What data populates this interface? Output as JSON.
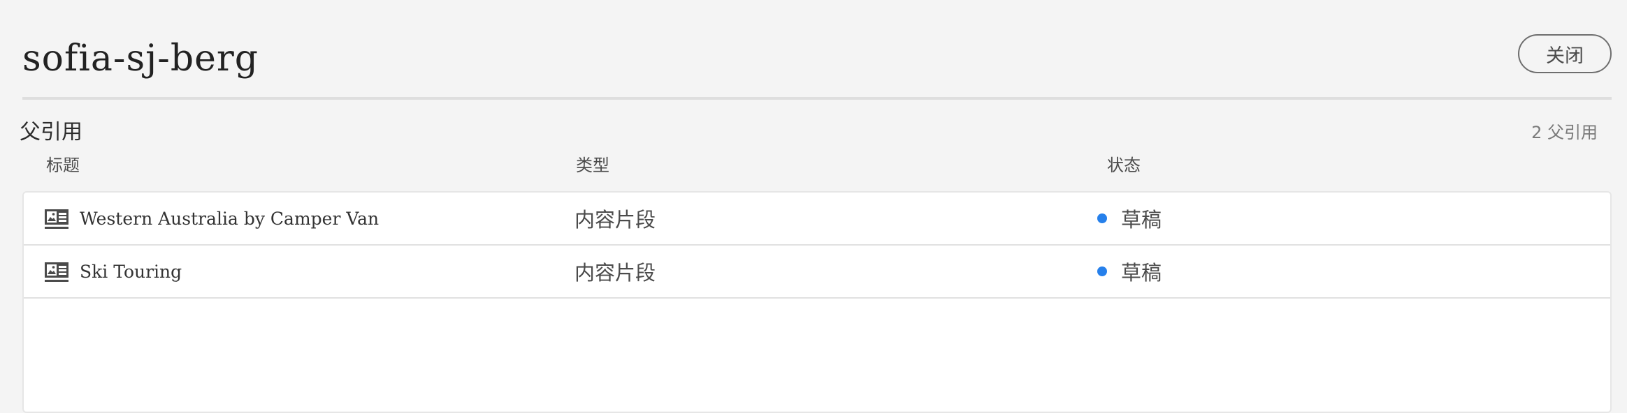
{
  "header": {
    "title": "sofia-sj-berg",
    "close_label": "关闭"
  },
  "section": {
    "title": "父引用",
    "count_label": "2 父引用"
  },
  "table": {
    "columns": [
      "标题",
      "类型",
      "状态"
    ],
    "rows": [
      {
        "icon": "content-fragment-icon",
        "title": "Western Australia by Camper Van",
        "type": "内容片段",
        "status": "草稿"
      },
      {
        "icon": "content-fragment-icon",
        "title": "Ski Touring",
        "type": "内容片段",
        "status": "草稿"
      }
    ]
  },
  "colors": {
    "status_draft": "#2680eb",
    "background": "#f4f4f4"
  }
}
